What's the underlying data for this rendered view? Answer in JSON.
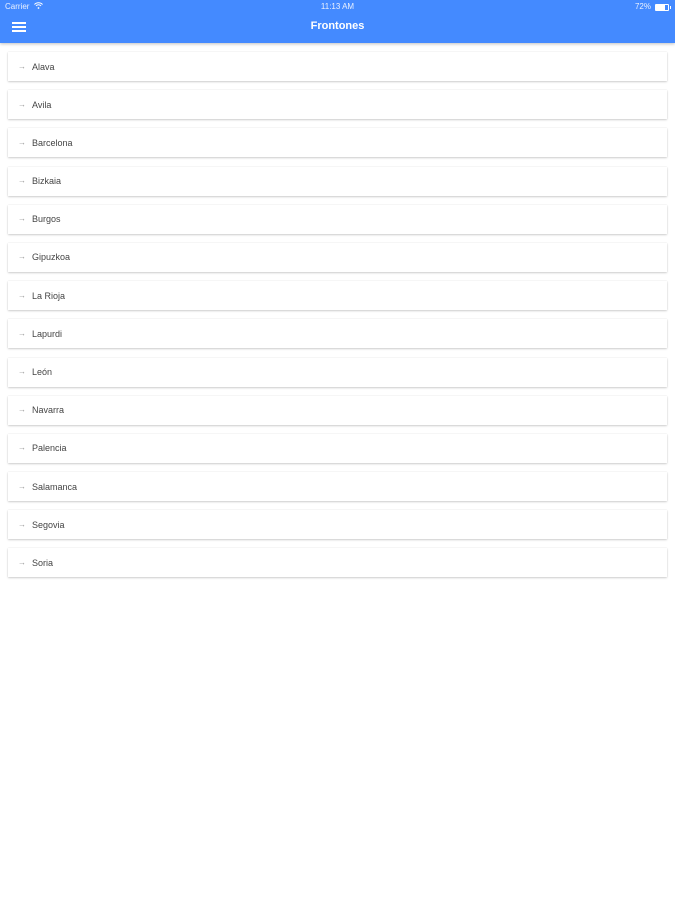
{
  "status_bar": {
    "carrier": "Carrier",
    "time": "11:13 AM",
    "battery": "72%",
    "battery_level": 0.72
  },
  "header": {
    "title": "Frontones"
  },
  "list": {
    "items": [
      "Alava",
      "Avila",
      "Barcelona",
      "Bizkaia",
      "Burgos",
      "Gipuzkoa",
      "La Rioja",
      "Lapurdi",
      "León",
      "Navarra",
      "Palencia",
      "Salamanca",
      "Segovia",
      "Soria"
    ],
    "item_icon": "arrow-right-icon"
  },
  "colors": {
    "header_bg": "#448aff",
    "background": "#ffffff"
  }
}
